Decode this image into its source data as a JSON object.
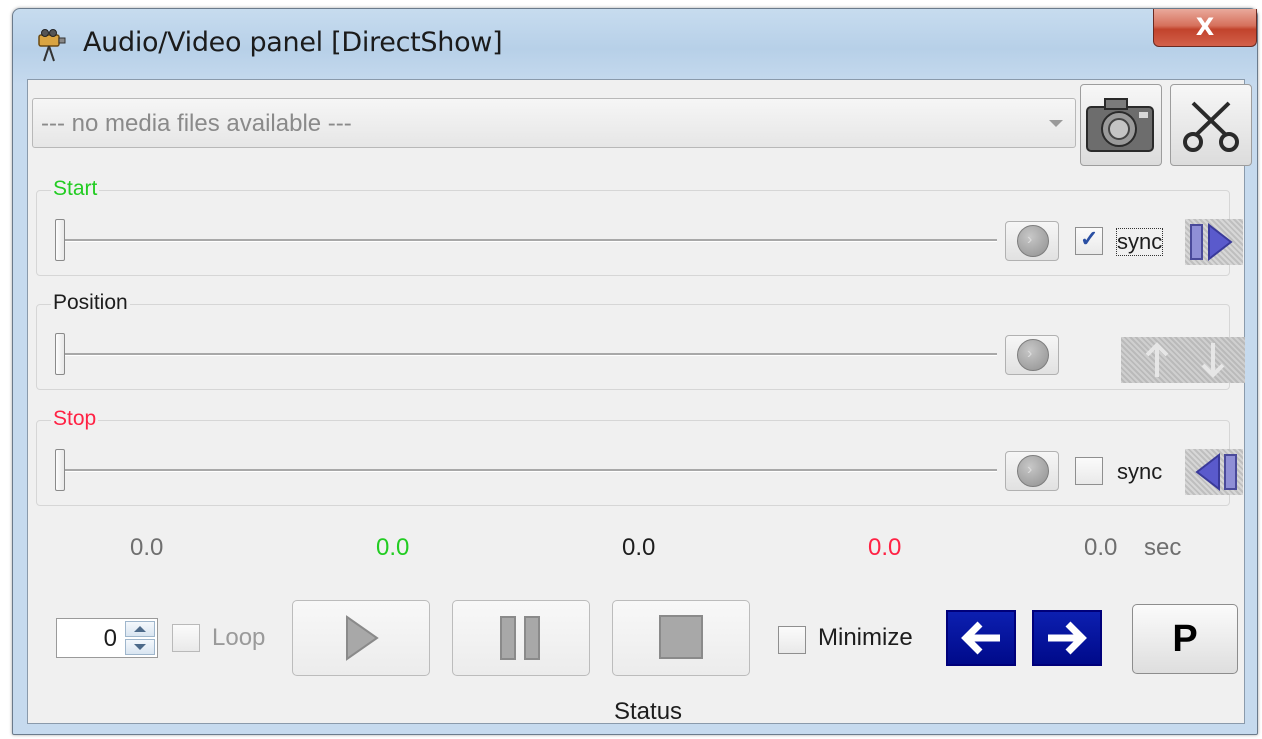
{
  "window": {
    "title": "Audio/Video panel [DirectShow]",
    "close_label": "X",
    "icon": "projector-icon"
  },
  "media": {
    "selected": "--- no media files available ---",
    "snapshot_icon": "camera-icon",
    "cut_icon": "scissors-icon"
  },
  "start": {
    "label": "Start",
    "sync_label": "sync",
    "sync_checked": true,
    "color": "#22cc22"
  },
  "position": {
    "label": "Position"
  },
  "stop": {
    "label": "Stop",
    "sync_label": "sync",
    "sync_checked": false,
    "color": "#ff2244"
  },
  "times": {
    "current": "0.0",
    "start": "0.0",
    "position": "0.0",
    "stop": "0.0",
    "duration": "0.0",
    "unit": "sec"
  },
  "controls": {
    "loop_count": "0",
    "loop_label": "Loop",
    "minimize_label": "Minimize",
    "p_label": "P",
    "status": "Status"
  }
}
